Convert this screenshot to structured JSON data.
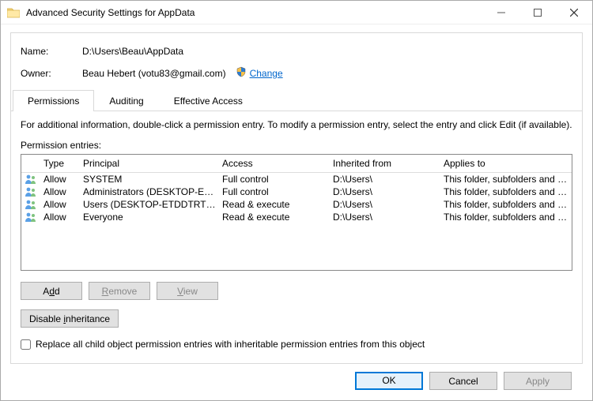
{
  "window": {
    "title": "Advanced Security Settings for AppData"
  },
  "fields": {
    "name_label": "Name:",
    "name_value": "D:\\Users\\Beau\\AppData",
    "owner_label": "Owner:",
    "owner_value": "Beau Hebert (votu83@gmail.com)",
    "change_link": "Change"
  },
  "tabs": {
    "permissions": "Permissions",
    "auditing": "Auditing",
    "effective": "Effective Access"
  },
  "text": {
    "info": "For additional information, double-click a permission entry. To modify a permission entry, select the entry and click Edit (if available).",
    "entries_label": "Permission entries:",
    "replace_children": "Replace all child object permission entries with inheritable permission entries from this object"
  },
  "columns": {
    "type": "Type",
    "principal": "Principal",
    "access": "Access",
    "inherited": "Inherited from",
    "applies": "Applies to"
  },
  "entries": [
    {
      "type": "Allow",
      "principal": "SYSTEM",
      "access": "Full control",
      "inherited": "D:\\Users\\",
      "applies": "This folder, subfolders and files"
    },
    {
      "type": "Allow",
      "principal": "Administrators (DESKTOP-ETD...",
      "access": "Full control",
      "inherited": "D:\\Users\\",
      "applies": "This folder, subfolders and files"
    },
    {
      "type": "Allow",
      "principal": "Users (DESKTOP-ETDDTRT\\Use...",
      "access": "Read & execute",
      "inherited": "D:\\Users\\",
      "applies": "This folder, subfolders and files"
    },
    {
      "type": "Allow",
      "principal": "Everyone",
      "access": "Read & execute",
      "inherited": "D:\\Users\\",
      "applies": "This folder, subfolders and files"
    }
  ],
  "buttons": {
    "add": "Add",
    "remove": "Remove",
    "view": "View",
    "disable_inheritance": "Disable inheritance",
    "ok": "OK",
    "cancel": "Cancel",
    "apply": "Apply"
  }
}
